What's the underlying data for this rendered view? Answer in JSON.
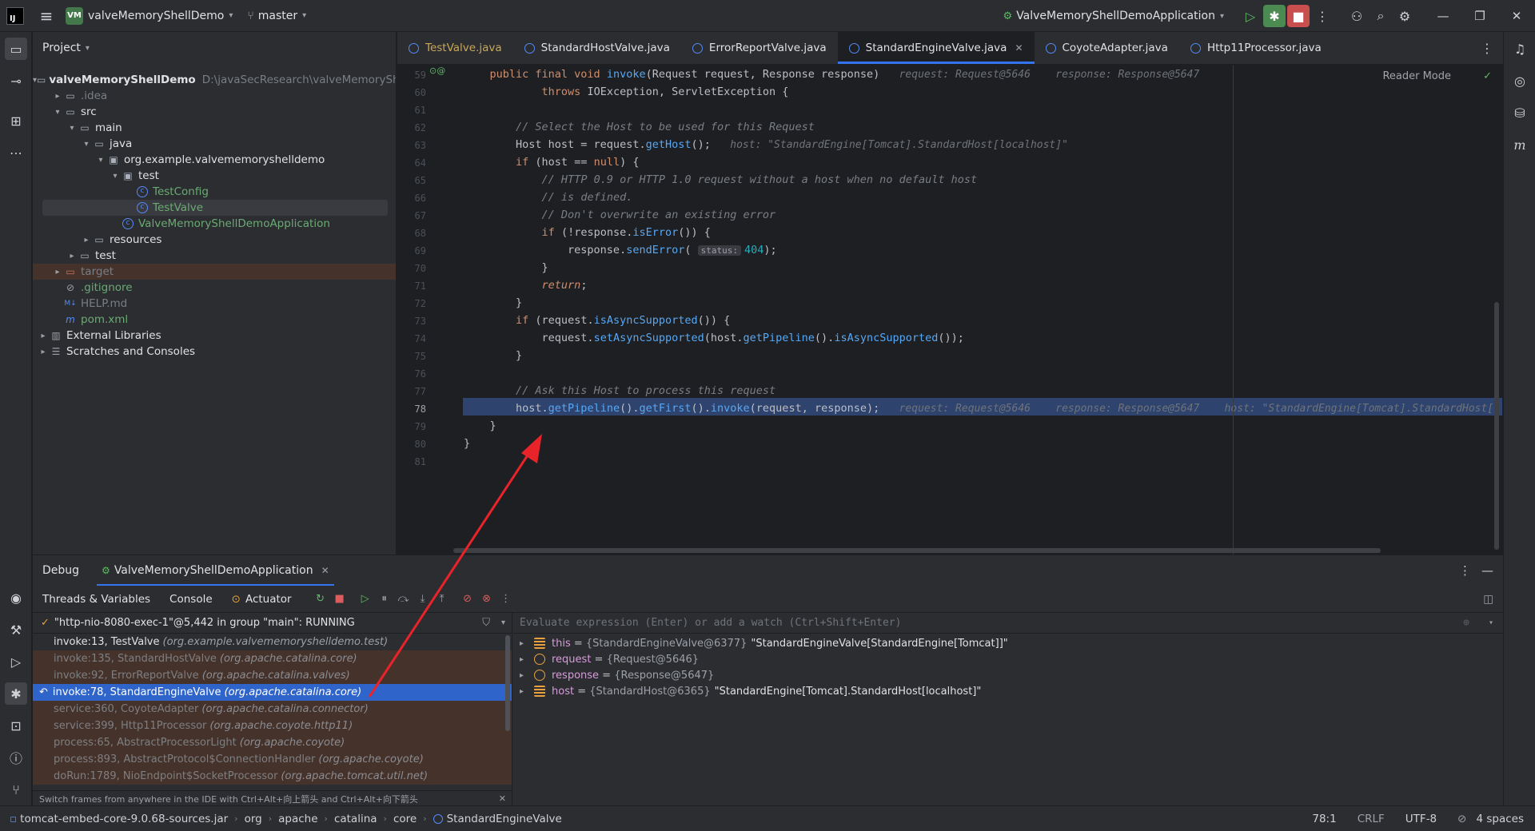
{
  "titlebar": {
    "project_badge": "VM",
    "project_name": "valveMemoryShellDemo",
    "branch": "master",
    "run_config": "ValveMemoryShellDemoApplication"
  },
  "project_panel": {
    "title": "Project",
    "tree": [
      {
        "label": "valveMemoryShellDemo",
        "path": "D:\\javaSecResearch\\valveMemoryShellDe",
        "depth": 0,
        "arrow": "▾",
        "kind": "module"
      },
      {
        "label": ".idea",
        "depth": 1,
        "arrow": "▸",
        "kind": "folder",
        "style": "dim"
      },
      {
        "label": "src",
        "depth": 1,
        "arrow": "▾",
        "kind": "folder"
      },
      {
        "label": "main",
        "depth": 2,
        "arrow": "▾",
        "kind": "folder"
      },
      {
        "label": "java",
        "depth": 3,
        "arrow": "▾",
        "kind": "folder"
      },
      {
        "label": "org.example.valvememoryshelldemo",
        "depth": 4,
        "arrow": "▾",
        "kind": "package"
      },
      {
        "label": "test",
        "depth": 5,
        "arrow": "▾",
        "kind": "package"
      },
      {
        "label": "TestConfig",
        "depth": 6,
        "arrow": "",
        "kind": "class",
        "style": "green"
      },
      {
        "label": "TestValve",
        "depth": 6,
        "arrow": "",
        "kind": "class",
        "style": "green",
        "selected": true
      },
      {
        "label": "ValveMemoryShellDemoApplication",
        "depth": 5,
        "arrow": "",
        "kind": "class",
        "style": "green"
      },
      {
        "label": "resources",
        "depth": 3,
        "arrow": "▸",
        "kind": "folder"
      },
      {
        "label": "test",
        "depth": 2,
        "arrow": "▸",
        "kind": "folder"
      },
      {
        "label": "target",
        "depth": 1,
        "arrow": "▸",
        "kind": "folder",
        "style": "excluded"
      },
      {
        "label": ".gitignore",
        "depth": 1,
        "arrow": "",
        "kind": "ignore",
        "style": "green"
      },
      {
        "label": "HELP.md",
        "depth": 1,
        "arrow": "",
        "kind": "md",
        "style": "dim"
      },
      {
        "label": "pom.xml",
        "depth": 1,
        "arrow": "",
        "kind": "maven",
        "style": "green"
      },
      {
        "label": "External Libraries",
        "depth": 0,
        "arrow": "▸",
        "kind": "libs"
      },
      {
        "label": "Scratches and Consoles",
        "depth": 0,
        "arrow": "▸",
        "kind": "scratch"
      }
    ]
  },
  "tabs": [
    {
      "label": "TestValve.java",
      "modified": true
    },
    {
      "label": "StandardHostValve.java"
    },
    {
      "label": "ErrorReportValve.java"
    },
    {
      "label": "StandardEngineValve.java",
      "active": true
    },
    {
      "label": "CoyoteAdapter.java"
    },
    {
      "label": "Http11Processor.java"
    }
  ],
  "editor": {
    "reader_mode": "Reader Mode",
    "current_line": 78,
    "lines": [
      {
        "n": 59,
        "html": "    <span class='kw'>public final void</span> <span class='fn'>invoke</span>(Request request, Response response)   <span class='hint'>request: Request@5646    response: Response@5647</span>"
      },
      {
        "n": 60,
        "html": "            <span class='kw'>throws</span> IOException, ServletException {"
      },
      {
        "n": 61,
        "html": ""
      },
      {
        "n": 62,
        "html": "        <span class='cm'>// Select the Host to be used for this Request</span>"
      },
      {
        "n": 63,
        "html": "        Host host = request.<span class='fn'>getHost</span>();   <span class='hint'>host: \"StandardEngine[Tomcat].StandardHost[localhost]\"</span>"
      },
      {
        "n": 64,
        "html": "        <span class='kw'>if</span> (host == <span class='kw'>null</span>) {"
      },
      {
        "n": 65,
        "html": "            <span class='cm'>// HTTP 0.9 or HTTP 1.0 request without a host when no default host</span>"
      },
      {
        "n": 66,
        "html": "            <span class='cm'>// is defined.</span>"
      },
      {
        "n": 67,
        "html": "            <span class='cm'>// Don't overwrite an existing error</span>"
      },
      {
        "n": 68,
        "html": "            <span class='kw'>if</span> (!response.<span class='fn'>isError</span>()) {"
      },
      {
        "n": 69,
        "html": "                response.<span class='fn'>sendError</span>( <span class='param-hint'>status:</span><span class='num'>404</span>);"
      },
      {
        "n": 70,
        "html": "            }"
      },
      {
        "n": 71,
        "html": "            <span class='kwi'>return</span>;"
      },
      {
        "n": 72,
        "html": "        }"
      },
      {
        "n": 73,
        "html": "        <span class='kw'>if</span> (request.<span class='fn'>isAsyncSupported</span>()) {"
      },
      {
        "n": 74,
        "html": "            request.<span class='fn'>setAsyncSupported</span>(host.<span class='fn'>getPipeline</span>().<span class='fn'>isAsyncSupported</span>());"
      },
      {
        "n": 75,
        "html": "        }"
      },
      {
        "n": 76,
        "html": ""
      },
      {
        "n": 77,
        "html": "        <span class='cm'>// Ask this Host to process this request</span>"
      },
      {
        "n": 78,
        "html": "        host.<span class='fn'>getPipeline</span>().<span class='fn'>getFirst</span>().<span class='fn'>invoke</span>(request, response);   <span class='hint'>request: Request@5646    response: Response@5647    host: \"StandardEngine[Tomcat].StandardHost[</span>"
      },
      {
        "n": 79,
        "html": "    }"
      },
      {
        "n": 80,
        "html": "}"
      },
      {
        "n": 81,
        "html": ""
      }
    ]
  },
  "debug": {
    "title": "Debug",
    "session": "ValveMemoryShellDemoApplication",
    "tabs": [
      "Threads & Variables",
      "Console",
      "Actuator"
    ],
    "thread": "\"http-nio-8080-exec-1\"@5,442 in group \"main\": RUNNING",
    "frames": [
      {
        "method": "invoke:13, TestValve",
        "pkg": "(org.example.valvememoryshelldemo.test)",
        "state": "user"
      },
      {
        "method": "invoke:135, StandardHostValve",
        "pkg": "(org.apache.catalina.core)",
        "state": "lib"
      },
      {
        "method": "invoke:92, ErrorReportValve",
        "pkg": "(org.apache.catalina.valves)",
        "state": "lib"
      },
      {
        "method": "invoke:78, StandardEngineValve",
        "pkg": "(org.apache.catalina.core)",
        "state": "sel"
      },
      {
        "method": "service:360, CoyoteAdapter",
        "pkg": "(org.apache.catalina.connector)",
        "state": "lib"
      },
      {
        "method": "service:399, Http11Processor",
        "pkg": "(org.apache.coyote.http11)",
        "state": "lib"
      },
      {
        "method": "process:65, AbstractProcessorLight",
        "pkg": "(org.apache.coyote)",
        "state": "lib"
      },
      {
        "method": "process:893, AbstractProtocol$ConnectionHandler",
        "pkg": "(org.apache.coyote)",
        "state": "lib"
      },
      {
        "method": "doRun:1789, NioEndpoint$SocketProcessor",
        "pkg": "(org.apache.tomcat.util.net)",
        "state": "lib"
      }
    ],
    "frames_hint": "Switch frames from anywhere in the IDE with Ctrl+Alt+向上箭头 and Ctrl+Alt+向下箭头",
    "eval_placeholder": "Evaluate expression (Enter) or add a watch (Ctrl+Shift+Enter)",
    "variables": [
      {
        "name": "this",
        "type": "{StandardEngineValve@6377}",
        "value": "\"StandardEngineValve[StandardEngine[Tomcat]]\"",
        "icon": "list"
      },
      {
        "name": "request",
        "type": "{Request@5646}",
        "value": "",
        "icon": "param"
      },
      {
        "name": "response",
        "type": "{Response@5647}",
        "value": "",
        "icon": "param"
      },
      {
        "name": "host",
        "type": "{StandardHost@6365}",
        "value": "\"StandardEngine[Tomcat].StandardHost[localhost]\"",
        "icon": "list"
      }
    ]
  },
  "statusbar": {
    "crumbs": [
      "tomcat-embed-core-9.0.68-sources.jar",
      "org",
      "apache",
      "catalina",
      "core",
      "StandardEngineValve"
    ],
    "position": "78:1",
    "line_sep": "CRLF",
    "encoding": "UTF-8",
    "indent": "4 spaces"
  },
  "colors": {
    "accent": "#3574f0",
    "annotation_arrow": "#e8232a"
  }
}
